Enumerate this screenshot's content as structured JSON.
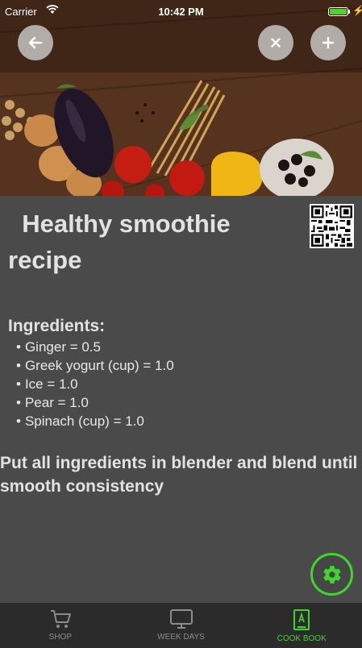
{
  "status_bar": {
    "carrier": "Carrier",
    "time": "10:42 PM",
    "battery_level": 1.0
  },
  "header": {
    "back_icon": "arrow-left-icon",
    "close_icon": "close-icon",
    "add_icon": "plus-icon"
  },
  "recipe": {
    "title": "Healthy smoothie recipe",
    "ingredients_title": "Ingredients:",
    "ingredients": [
      "Ginger = 0.5",
      "Greek yogurt (cup) = 1.0",
      "Ice = 1.0",
      "Pear = 1.0",
      "Spinach (cup) = 1.0"
    ],
    "instructions": "Put all ingredients in blender and blend until smooth consistency"
  },
  "tabs": [
    {
      "label": "SHOP",
      "icon": "cart-icon",
      "active": false
    },
    {
      "label": "WEEK DAYS",
      "icon": "monitor-icon",
      "active": false
    },
    {
      "label": "COOK BOOK",
      "icon": "book-icon",
      "active": true
    }
  ],
  "colors": {
    "accent": "#3ed72a",
    "background": "#4a4a4a",
    "tabbar": "#2b2b2b"
  }
}
